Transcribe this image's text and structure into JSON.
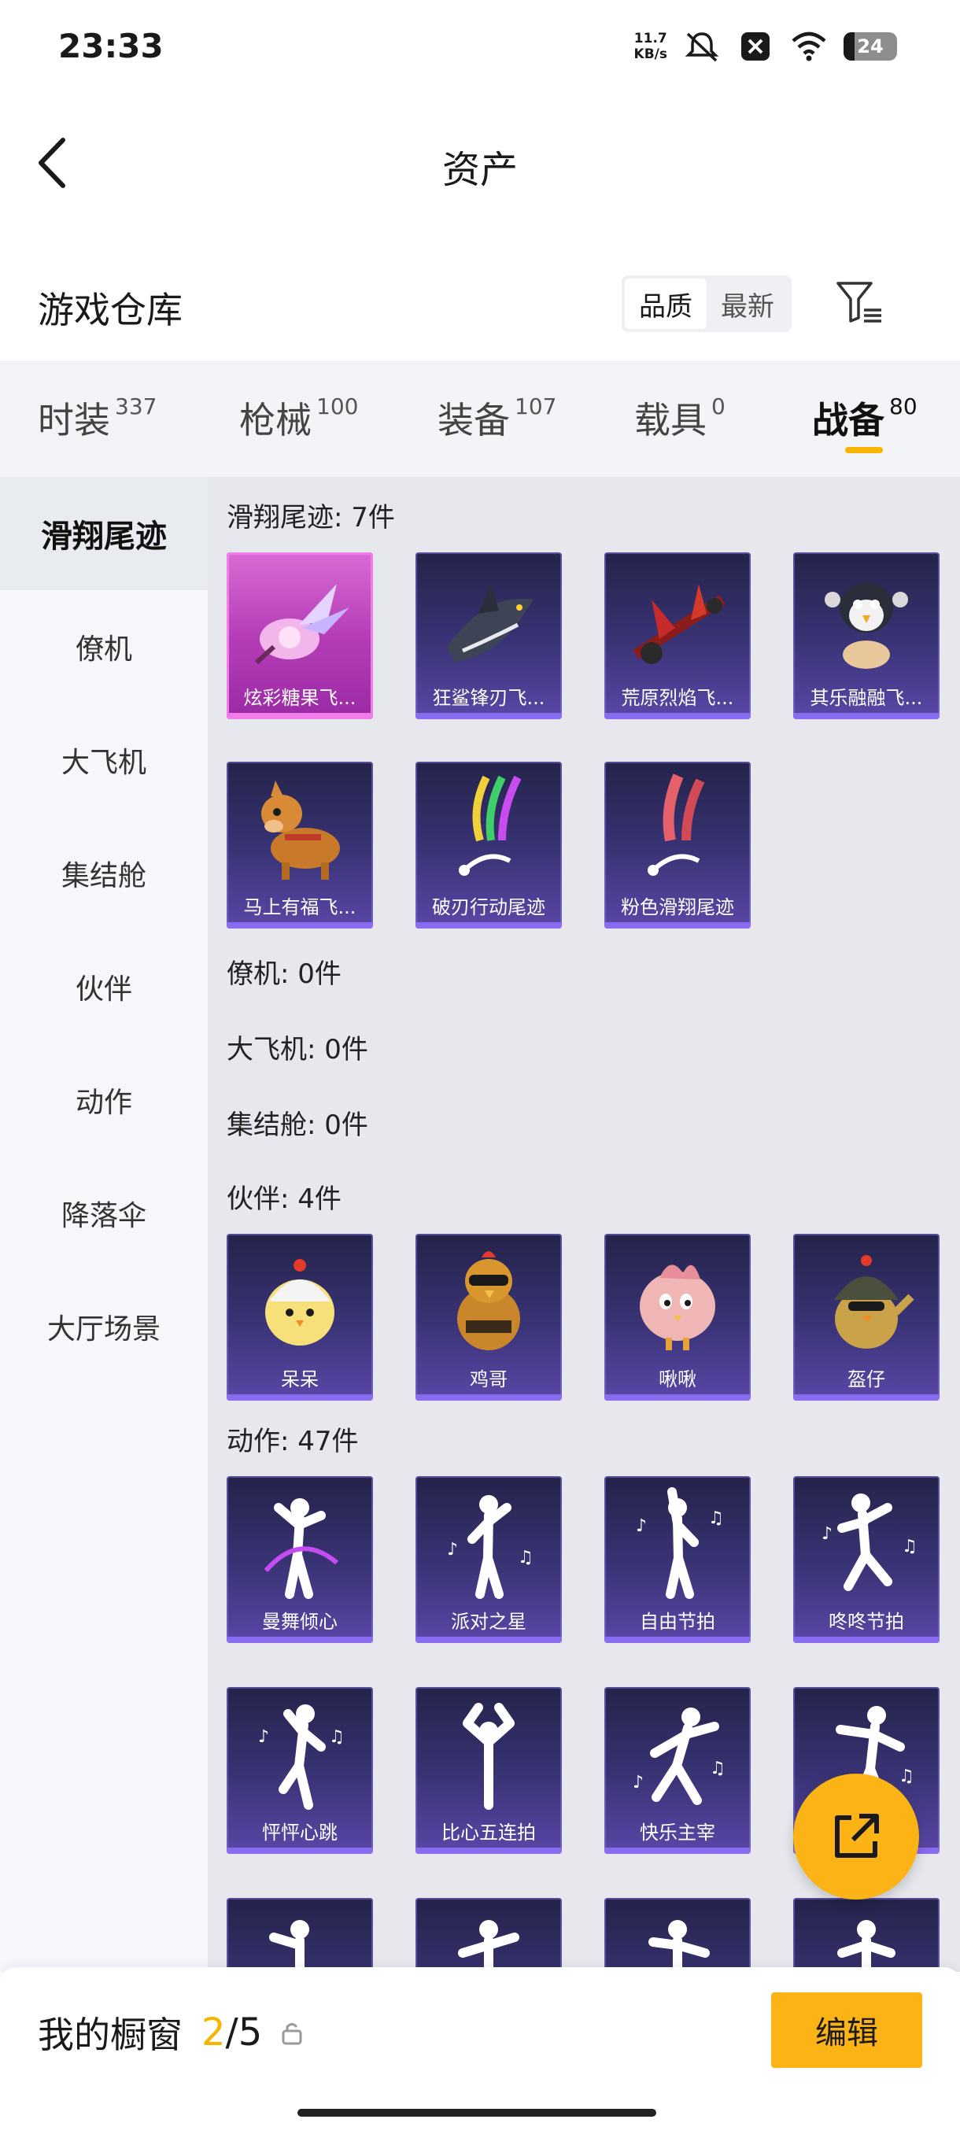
{
  "status_bar": {
    "time": "23:33",
    "speed_value": "11.7",
    "speed_unit": "KB/s",
    "battery": "24"
  },
  "header": {
    "title": "资产",
    "back_icon": "chevron-left-icon"
  },
  "warehouse": {
    "title": "游戏仓库",
    "sort_options": [
      "品质",
      "最新"
    ],
    "active_sort": "品质"
  },
  "tabs": [
    {
      "label": "时装",
      "count": "337"
    },
    {
      "label": "枪械",
      "count": "100"
    },
    {
      "label": "装备",
      "count": "107"
    },
    {
      "label": "载具",
      "count": "0"
    },
    {
      "label": "战备",
      "count": "80"
    }
  ],
  "active_tab": "战备",
  "sidebar": [
    "滑翔尾迹",
    "僚机",
    "大飞机",
    "集结舱",
    "伙伴",
    "动作",
    "降落伞",
    "大厅场景"
  ],
  "active_sidebar": "滑翔尾迹",
  "sections": {
    "glide": {
      "title": "滑翔尾迹: 7件",
      "items": [
        "炫彩糖果飞...",
        "狂鲨锋刃飞...",
        "荒原烈焰飞...",
        "其乐融融飞...",
        "马上有福飞...",
        "破刃行动尾迹",
        "粉色滑翔尾迹"
      ]
    },
    "wingman": {
      "title": "僚机: 0件"
    },
    "plane": {
      "title": "大飞机: 0件"
    },
    "pod": {
      "title": "集结舱: 0件"
    },
    "partner": {
      "title": "伙伴: 4件",
      "items": [
        "呆呆",
        "鸡哥",
        "啾啾",
        "盔仔"
      ]
    },
    "emote": {
      "title": "动作: 47件",
      "items": [
        "曼舞倾心",
        "派对之星",
        "自由节拍",
        "咚咚节拍",
        "怦怦心跳",
        "比心五连拍",
        "快乐主宰",
        ""
      ]
    }
  },
  "bottom": {
    "title": "我的橱窗",
    "current": "2",
    "separator": "/",
    "total": "5",
    "edit_label": "编辑"
  },
  "colors": {
    "accent": "#fcb315",
    "tab_underline": "#f7b500",
    "card_purple": "#3a3477",
    "card_pink": "#c04ac0"
  }
}
